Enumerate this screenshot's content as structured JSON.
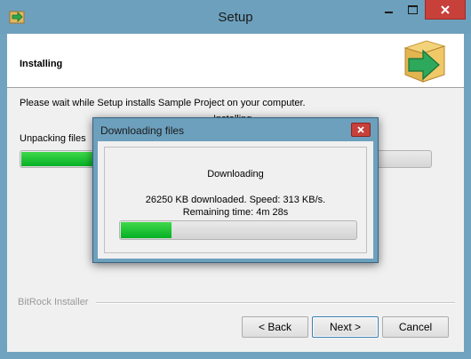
{
  "window": {
    "title": "Setup",
    "icon": "installer-arrow-icon"
  },
  "header": {
    "title": "Installing",
    "logo_icon": "package-box-arrow-icon"
  },
  "content": {
    "description": "Please wait while Setup installs Sample Project on your computer.",
    "partial_label": "Installing",
    "unpack_label": "Unpacking files",
    "progress": 0.18
  },
  "footer": {
    "brand": "BitRock Installer"
  },
  "buttons": {
    "back": "< Back",
    "next": "Next >",
    "cancel": "Cancel"
  },
  "dialog": {
    "title": "Downloading files",
    "status": "Downloading",
    "detail": "26250 KB downloaded. Speed: 313 KB/s. Remaining time: 4m 28s",
    "progress": 0.22
  },
  "colors": {
    "titlebar": "#6da0bd",
    "close": "#c7403a",
    "progress_green": "#06b025"
  }
}
